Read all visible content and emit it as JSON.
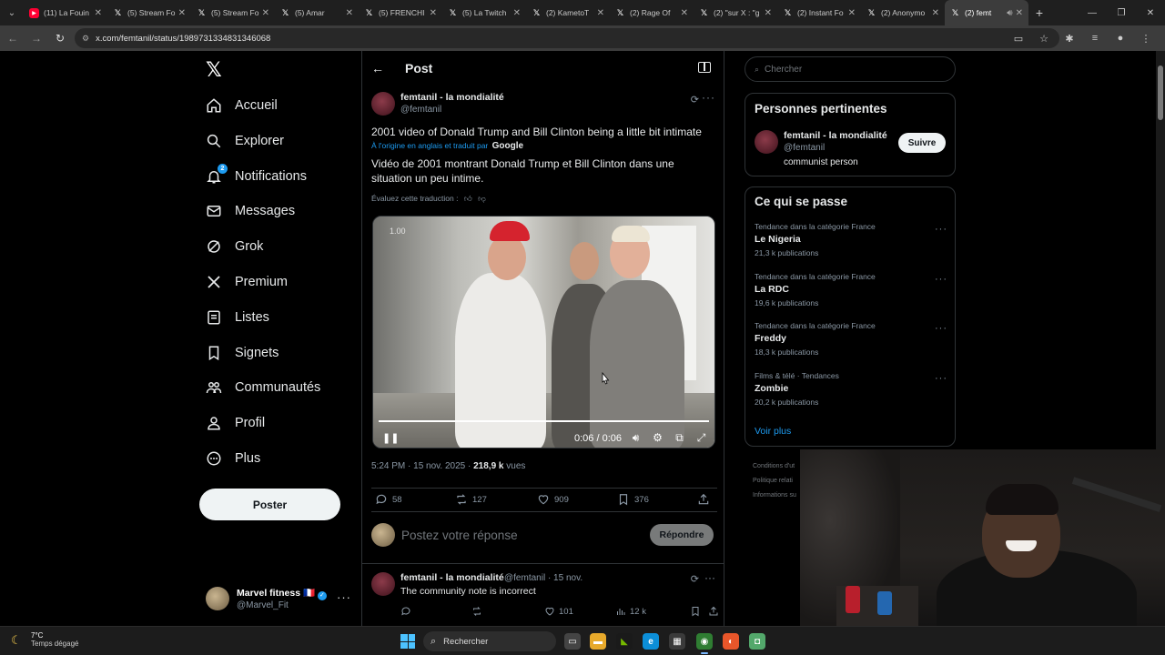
{
  "browser": {
    "tabs": [
      {
        "label": "(11) La Fouin",
        "favicon": "youtube-icon"
      },
      {
        "label": "(5) Stream Fo",
        "favicon": "x-icon"
      },
      {
        "label": "(5) Stream Fo",
        "favicon": "x-icon"
      },
      {
        "label": "(5) Amar",
        "favicon": "x-icon"
      },
      {
        "label": "(5) FRENCHI",
        "favicon": "x-icon"
      },
      {
        "label": "(5) La Twitch",
        "favicon": "x-icon"
      },
      {
        "label": "(2) KametoT",
        "favicon": "x-icon"
      },
      {
        "label": "(2) Rage Of",
        "favicon": "x-icon"
      },
      {
        "label": "(2) \"sur X : \"g",
        "favicon": "x-icon"
      },
      {
        "label": "(2) Instant Fo",
        "favicon": "x-icon"
      },
      {
        "label": "(2) Anonymo",
        "favicon": "x-icon"
      },
      {
        "label": "(2) femt",
        "favicon": "x-icon",
        "active": true
      }
    ],
    "url": "x.com/femtanil/status/1989731334831346068"
  },
  "nav": {
    "items": [
      {
        "label": "Accueil",
        "icon": "home-icon"
      },
      {
        "label": "Explorer",
        "icon": "search-icon"
      },
      {
        "label": "Notifications",
        "icon": "bell-icon",
        "badge": "2"
      },
      {
        "label": "Messages",
        "icon": "envelope-icon"
      },
      {
        "label": "Grok",
        "icon": "grok-icon"
      },
      {
        "label": "Premium",
        "icon": "x-logo-icon"
      },
      {
        "label": "Listes",
        "icon": "list-icon"
      },
      {
        "label": "Signets",
        "icon": "bookmark-icon"
      },
      {
        "label": "Communautés",
        "icon": "communities-icon"
      },
      {
        "label": "Profil",
        "icon": "person-icon"
      },
      {
        "label": "Plus",
        "icon": "more-circle-icon"
      }
    ],
    "post_button": "Poster",
    "account": {
      "name": "Marvel fitness 🇫🇷",
      "handle": "@Marvel_Fit"
    }
  },
  "post": {
    "header_title": "Post",
    "author_name": "femtanil - la mondialité",
    "author_handle": "@femtanil",
    "text": "2001 video of Donald Trump and Bill Clinton being a little bit intimate",
    "translated_note": "À l'origine en anglais et traduit par",
    "translator": "Google",
    "translation": "Vidéo de 2001 montrant Donald Trump et Bill Clinton dans une situation un peu intime.",
    "rate_translation": "Évaluez cette traduction :",
    "video": {
      "speed": "1.00",
      "time": "0:06 / 0:06",
      "progress": 1.0
    },
    "time": "5:24 PM · 15 nov. 2025 ·",
    "views": "218,9 k",
    "views_label": "vues",
    "stats": {
      "replies": "58",
      "reposts": "127",
      "likes": "909",
      "bookmarks": "376"
    },
    "reply_placeholder": "Postez votre réponse",
    "reply_button": "Répondre"
  },
  "reply": {
    "name": "femtanil - la mondialité",
    "handle": "@femtanil · 15 nov.",
    "text": "The community note is incorrect",
    "likes": "101",
    "views": "12 k"
  },
  "sidebar": {
    "search_placeholder": "Chercher",
    "relevant_title": "Personnes pertinentes",
    "relevant": {
      "name": "femtanil - la mondialité",
      "handle": "@femtanil",
      "bio": "communist person",
      "follow": "Suivre"
    },
    "trends_title": "Ce qui se passe",
    "trends": [
      {
        "context": "Tendance dans la catégorie France",
        "name": "Le Nigeria",
        "posts": "21,3 k publications"
      },
      {
        "context": "Tendance dans la catégorie France",
        "name": "La RDC",
        "posts": "19,6 k publications"
      },
      {
        "context": "Tendance dans la catégorie France",
        "name": "Freddy",
        "posts": "18,3 k publications"
      },
      {
        "context": "Films & télé · Tendances",
        "name": "Zombie",
        "posts": "20,2 k publications"
      }
    ],
    "more": "Voir plus",
    "footer": [
      "Conditions d'ut",
      "Politique relati",
      "Informations su"
    ]
  },
  "taskbar": {
    "temp": "7°C",
    "weather": "Temps dégagé",
    "search": "Rechercher"
  },
  "colors": {
    "accent": "#1d9bf0",
    "background": "#000000",
    "border": "#2f3336"
  }
}
